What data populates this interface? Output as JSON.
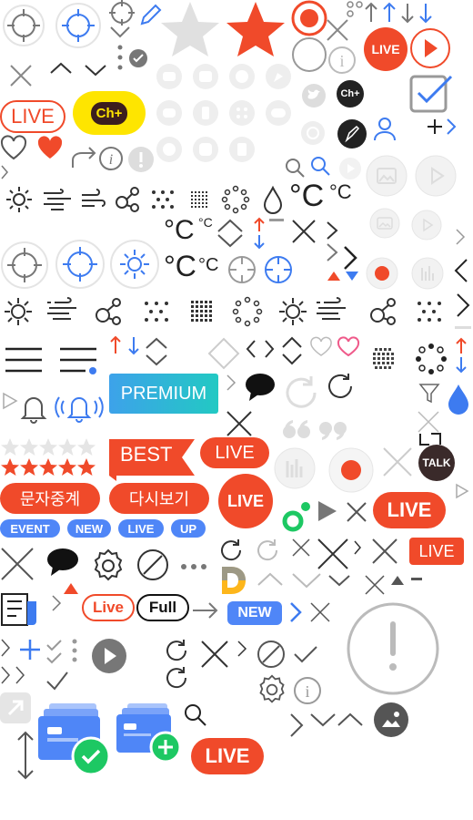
{
  "colors": {
    "live_red": "#f04a2a",
    "blue": "#3d7bf0",
    "kakao_yellow": "#fee500",
    "gray": "#999999",
    "light_gray": "#dddddd",
    "dark": "#222222",
    "premium_start": "#3da2ea",
    "premium_end": "#22c9c3",
    "green": "#1dc863",
    "badge_blue": "#4f86f7"
  },
  "badges": {
    "live": "LIVE",
    "ch_plus": "Ch+",
    "premium": "PREMIUM",
    "best": "BEST",
    "text_relay": "문자중계",
    "replay": "다시보기",
    "event": "EVENT",
    "new": "NEW",
    "up": "UP",
    "talk": "TALK",
    "live_mixed": "Live",
    "full": "Full",
    "celsius": "°C"
  }
}
